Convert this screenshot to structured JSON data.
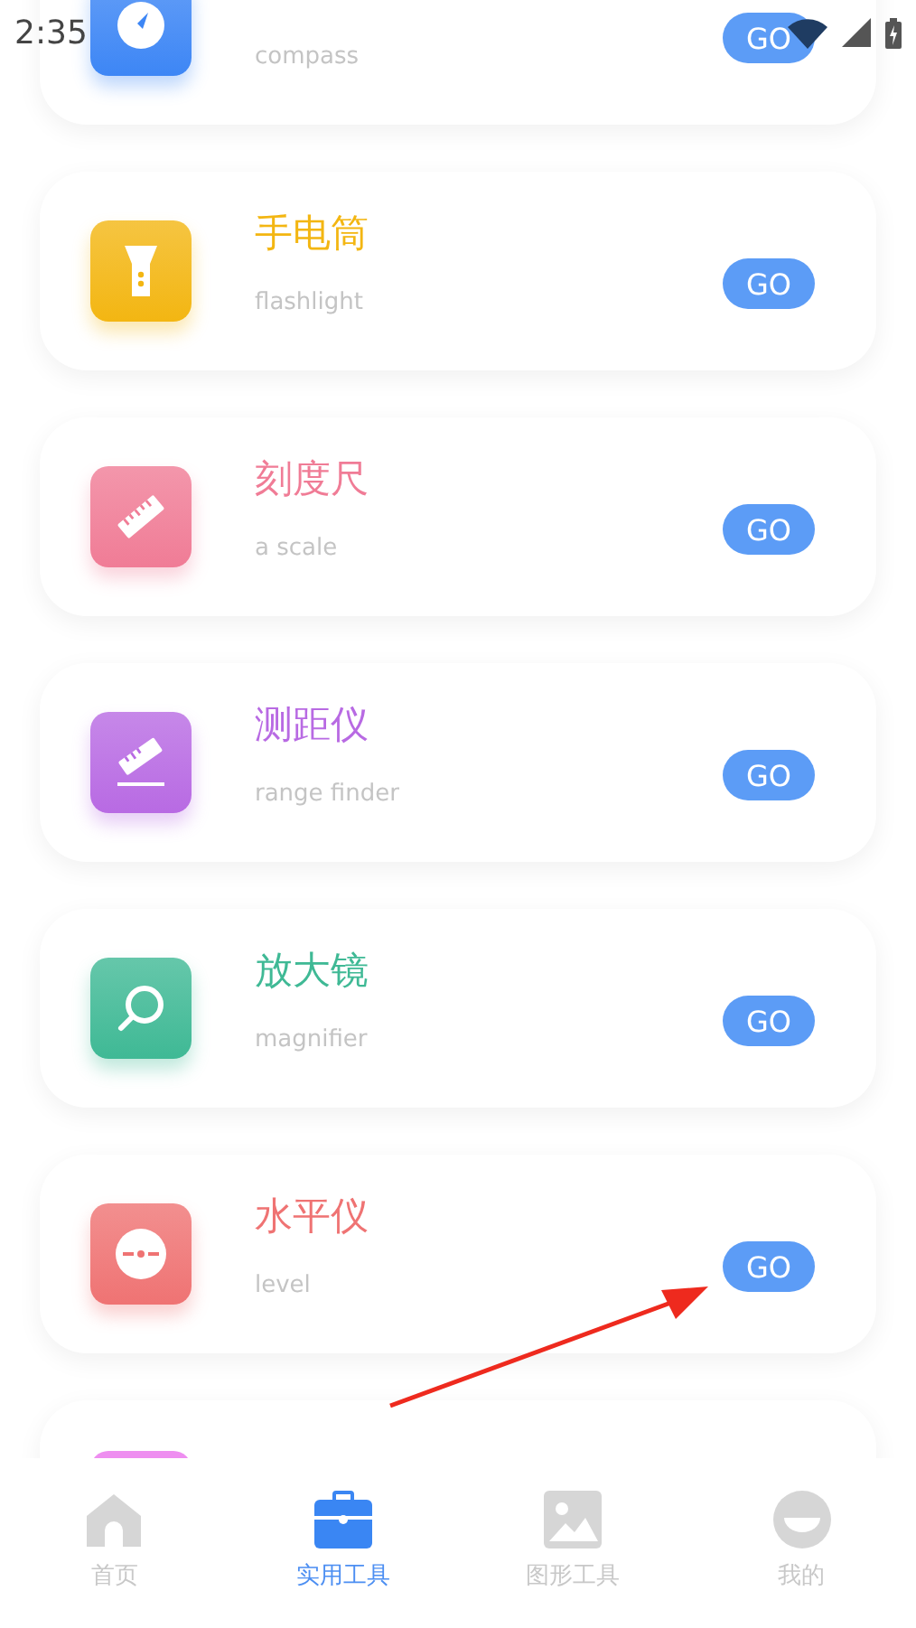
{
  "status_bar": {
    "time": "2:35"
  },
  "tools": [
    {
      "kind": "compass",
      "subtitle": "compass",
      "color": "#3d86f5",
      "button": "GO"
    },
    {
      "kind": "flashlight",
      "title": "手电筒",
      "subtitle": "flashlight",
      "color": "#f3b612",
      "button": "GO"
    },
    {
      "kind": "ruler",
      "title": "刻度尺",
      "subtitle": "a scale",
      "color": "#f07c96",
      "button": "GO"
    },
    {
      "kind": "range",
      "title": "测距仪",
      "subtitle": "range finder",
      "color": "#b86ae3",
      "button": "GO"
    },
    {
      "kind": "magnifier",
      "title": "放大镜",
      "subtitle": "magnifier",
      "color": "#3fb995",
      "button": "GO"
    },
    {
      "kind": "level",
      "title": "水平仪",
      "subtitle": "level",
      "color": "#ef7373",
      "button": "GO"
    }
  ],
  "peek_card": {
    "color": "#ee8ef0"
  },
  "annotation_arrow": true,
  "tab_bar": [
    {
      "kind": "home",
      "label": "首页",
      "selected": false
    },
    {
      "kind": "toolbox",
      "label": "实用工具",
      "selected": true
    },
    {
      "kind": "image",
      "label": "图形工具",
      "selected": false
    },
    {
      "kind": "profile",
      "label": "我的",
      "selected": false
    }
  ]
}
